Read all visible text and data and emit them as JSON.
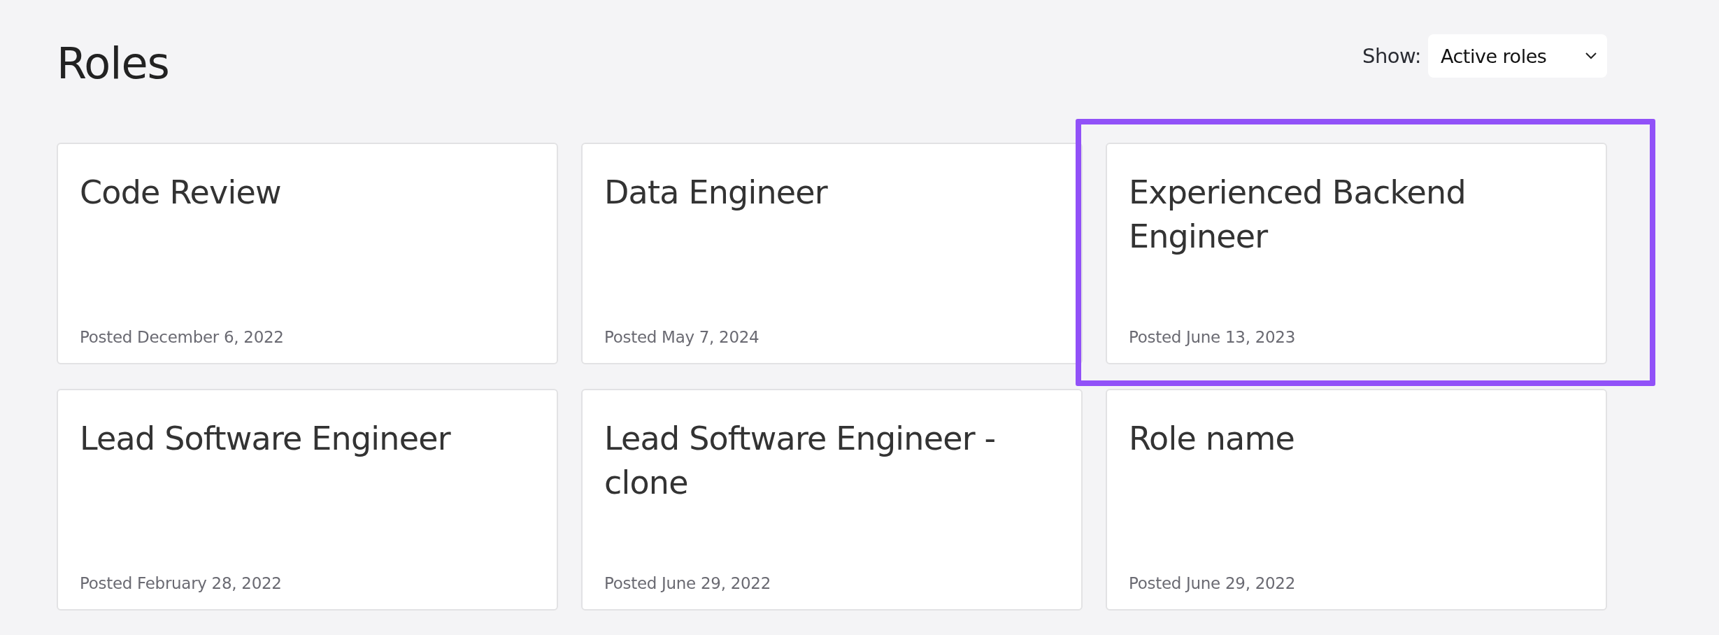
{
  "page": {
    "title": "Roles"
  },
  "filter": {
    "label": "Show:",
    "value": "Active roles"
  },
  "roles": [
    {
      "name": "Code Review",
      "posted": "Posted December 6, 2022",
      "highlighted": false
    },
    {
      "name": "Data Engineer",
      "posted": "Posted May 7, 2024",
      "highlighted": false
    },
    {
      "name": "Experienced Backend Engineer",
      "posted": "Posted June 13, 2023",
      "highlighted": true
    },
    {
      "name": "Lead Software Engineer",
      "posted": "Posted February 28, 2022",
      "highlighted": false
    },
    {
      "name": "Lead Software Engineer - clone",
      "posted": "Posted June 29, 2022",
      "highlighted": false
    },
    {
      "name": "Role name",
      "posted": "Posted June 29, 2022",
      "highlighted": false
    }
  ]
}
